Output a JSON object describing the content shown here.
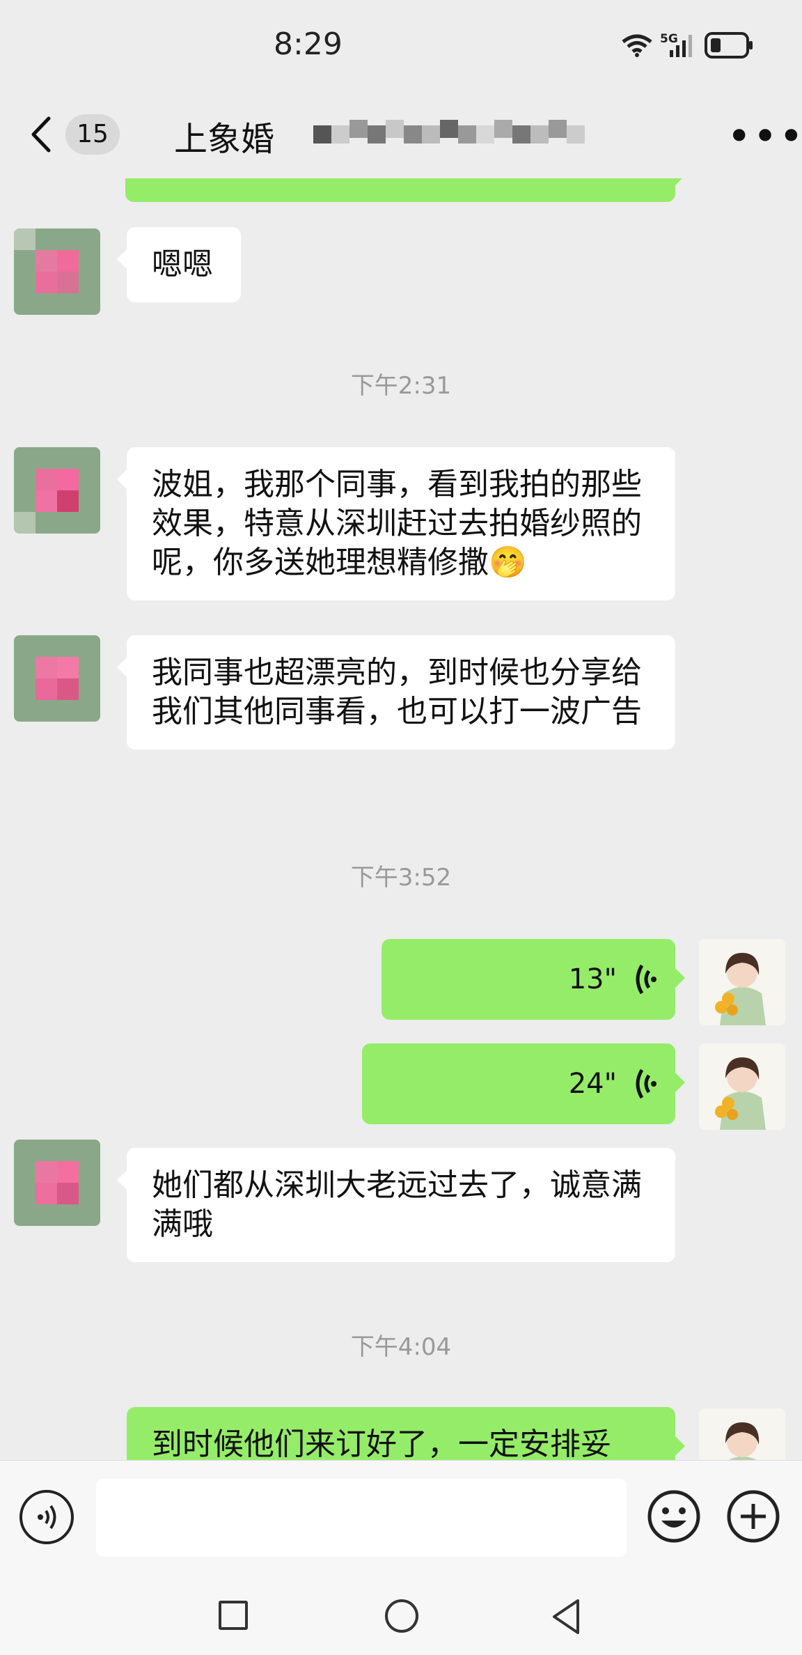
{
  "status_bar": {
    "time": "8:29",
    "network": "5G"
  },
  "header": {
    "unread_count": "15",
    "title": "上象婚"
  },
  "messages": [
    {
      "side": "in",
      "text": "嗯嗯"
    },
    {
      "type": "time",
      "text": "下午2:31"
    },
    {
      "side": "in",
      "text": "波姐，我那个同事，看到我拍的那些效果，特意从深圳赶过去拍婚纱照的呢，你多送她理想精修撒🤭"
    },
    {
      "side": "in",
      "text": "我同事也超漂亮的，到时候也分享给我们其他同事看，也可以打一波广告"
    },
    {
      "type": "time",
      "text": "下午3:52"
    },
    {
      "side": "out",
      "voice": "13\""
    },
    {
      "side": "out",
      "voice": "24\""
    },
    {
      "side": "in",
      "text": "她们都从深圳大老远过去了，诚意满满哦"
    },
    {
      "type": "time",
      "text": "下午4:04"
    },
    {
      "side": "out",
      "text": "到时候他们来订好了，一定安排妥"
    }
  ],
  "input": {
    "placeholder": ""
  },
  "icons": [
    "wifi-icon",
    "signal-icon",
    "battery-icon",
    "back-icon",
    "more-icon",
    "voice-wave-icon",
    "voice-input-icon",
    "emoji-icon",
    "plus-icon",
    "nav-square-icon",
    "nav-home-icon",
    "nav-back-icon"
  ],
  "colors": {
    "background": "#ededed",
    "incoming_bubble": "#ffffff",
    "outgoing_bubble": "#95ec69",
    "timestamp": "#999999"
  }
}
